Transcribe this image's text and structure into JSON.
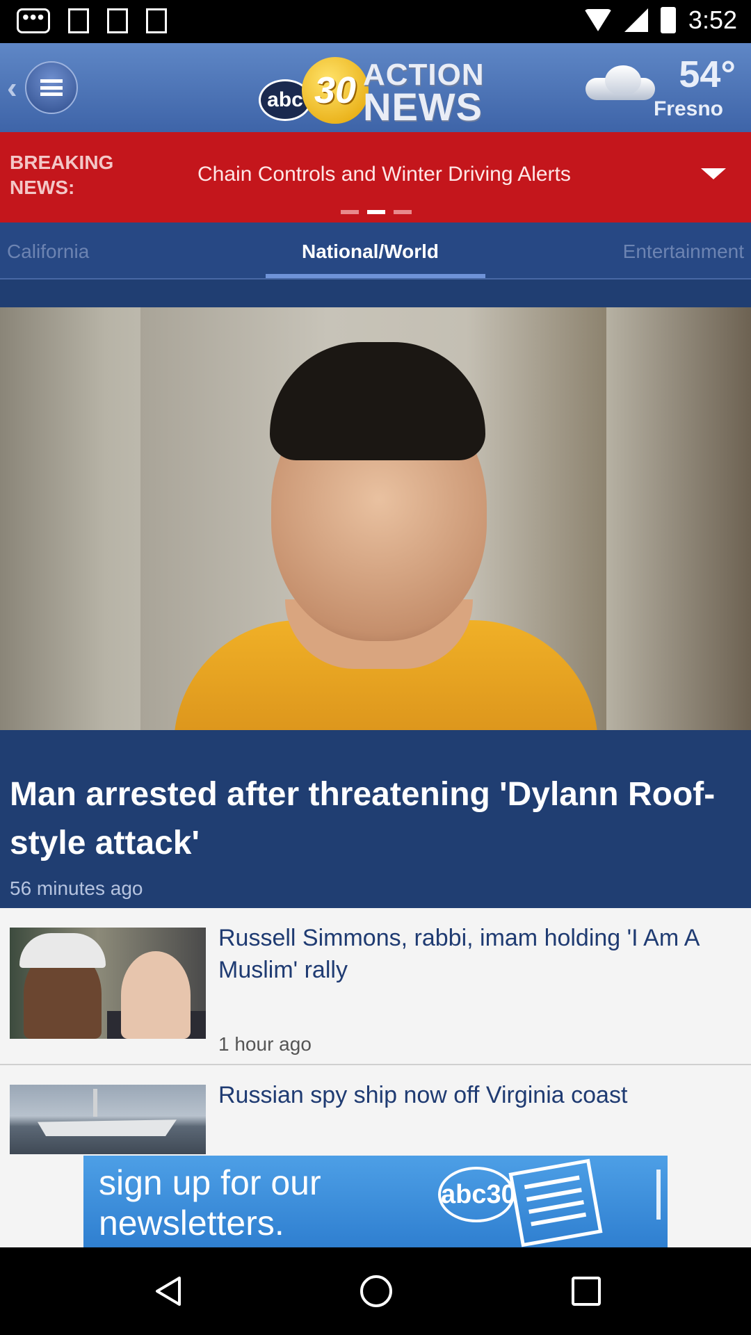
{
  "status_bar": {
    "time": "3:52"
  },
  "header": {
    "back_symbol": "‹",
    "logo": {
      "abc": "abc",
      "number": "30",
      "word1": "ACTION",
      "word2": "NEWS"
    },
    "weather": {
      "temperature": "54°",
      "city": "Fresno",
      "icon": "cloud-icon"
    }
  },
  "breaking": {
    "label": "BREAKING NEWS:",
    "headline": "Chain Controls and Winter Driving Alerts",
    "page_count": 3,
    "active_page": 2
  },
  "tabs": [
    {
      "label": "California",
      "selected": false
    },
    {
      "label": "National/World",
      "selected": true
    },
    {
      "label": "Entertainment",
      "selected": false
    }
  ],
  "featured": {
    "title": "Man arrested after threatening 'Dylann Roof-style attack'",
    "time": "56 minutes ago"
  },
  "stories": [
    {
      "title": "Russell Simmons, rabbi, imam holding 'I Am A Muslim' rally",
      "time": "1 hour ago"
    },
    {
      "title": "Russian spy ship now off Virginia coast"
    }
  ],
  "ad": {
    "text": "sign up for our newsletters.",
    "logo": "abc30"
  },
  "colors": {
    "header_blue": "#3e64a8",
    "breaking_red": "#c4161c",
    "tab_bar": "#274884",
    "featured_bg": "#203e72"
  }
}
